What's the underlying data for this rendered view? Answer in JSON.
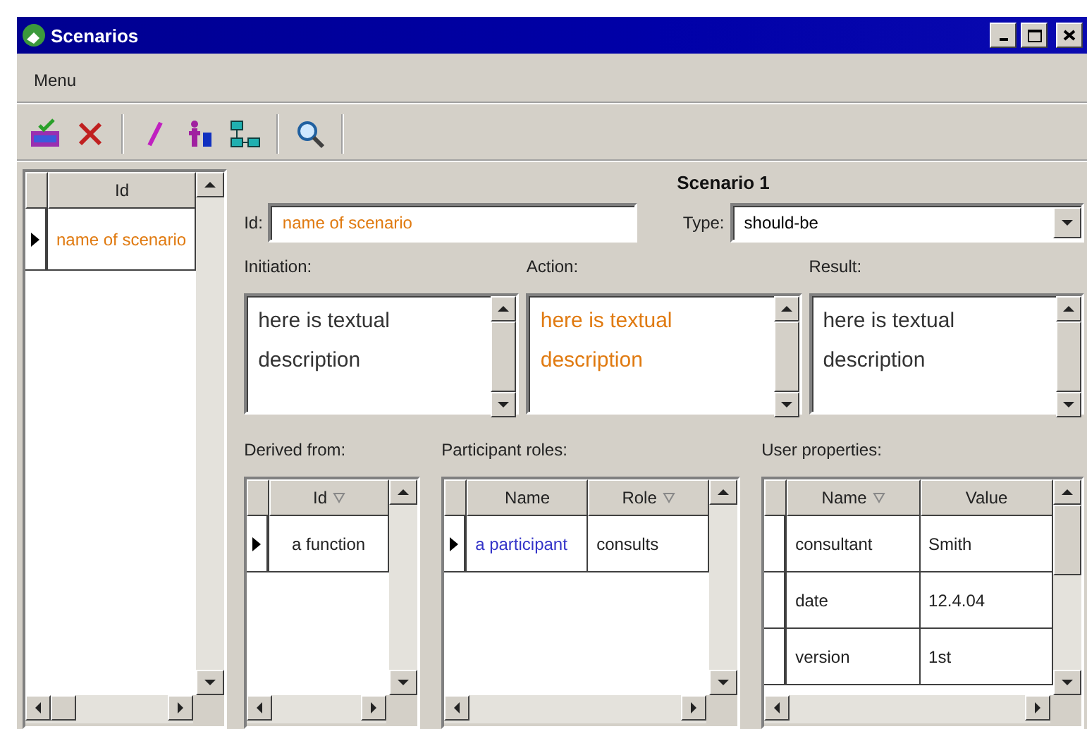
{
  "window": {
    "title": "Scenarios"
  },
  "menu": [
    {
      "label": "Menu"
    }
  ],
  "scenarios_grid": {
    "columns": [
      {
        "label": "Id",
        "sorted": false
      }
    ],
    "rows": [
      {
        "selected": true,
        "cells": [
          {
            "text": "name of scenario",
            "color": "#e07a10"
          }
        ]
      }
    ]
  },
  "detail": {
    "heading": "Scenario 1",
    "id": {
      "label": "Id:",
      "value": "name of scenario"
    },
    "type": {
      "label": "Type:",
      "value": "should-be"
    },
    "descriptions": [
      {
        "label": "Initiation:",
        "text": "here is textual description",
        "color": "#333333"
      },
      {
        "label": "Action:",
        "text": "here is textual description",
        "color": "#e07a10"
      },
      {
        "label": "Result:",
        "text": "here is textual description",
        "color": "#333333"
      }
    ],
    "tables": [
      {
        "label": "Derived from:",
        "columns": [
          {
            "label": "Id",
            "sorted": true
          }
        ],
        "rows": [
          {
            "selected": true,
            "cells": [
              {
                "text": "a function",
                "color": "#222222"
              }
            ]
          }
        ]
      },
      {
        "label": "Participant roles:",
        "columns": [
          {
            "label": "Name",
            "sorted": false
          },
          {
            "label": "Role",
            "sorted": true
          }
        ],
        "rows": [
          {
            "selected": true,
            "cells": [
              {
                "text": "a participant",
                "color": "#3434c8"
              },
              {
                "text": "consults",
                "color": "#222222"
              }
            ]
          }
        ]
      },
      {
        "label": "User properties:",
        "columns": [
          {
            "label": "Name",
            "sorted": true
          },
          {
            "label": "Value",
            "sorted": false
          }
        ],
        "rows": [
          {
            "selected": false,
            "cells": [
              {
                "text": "consultant",
                "color": "#222222"
              },
              {
                "text": "Smith",
                "color": "#222222"
              }
            ]
          },
          {
            "selected": false,
            "cells": [
              {
                "text": "date",
                "color": "#222222"
              },
              {
                "text": "12.4.04",
                "color": "#222222"
              }
            ]
          },
          {
            "selected": false,
            "cells": [
              {
                "text": "version",
                "color": "#222222"
              },
              {
                "text": "1st",
                "color": "#222222"
              }
            ]
          }
        ]
      }
    ]
  }
}
